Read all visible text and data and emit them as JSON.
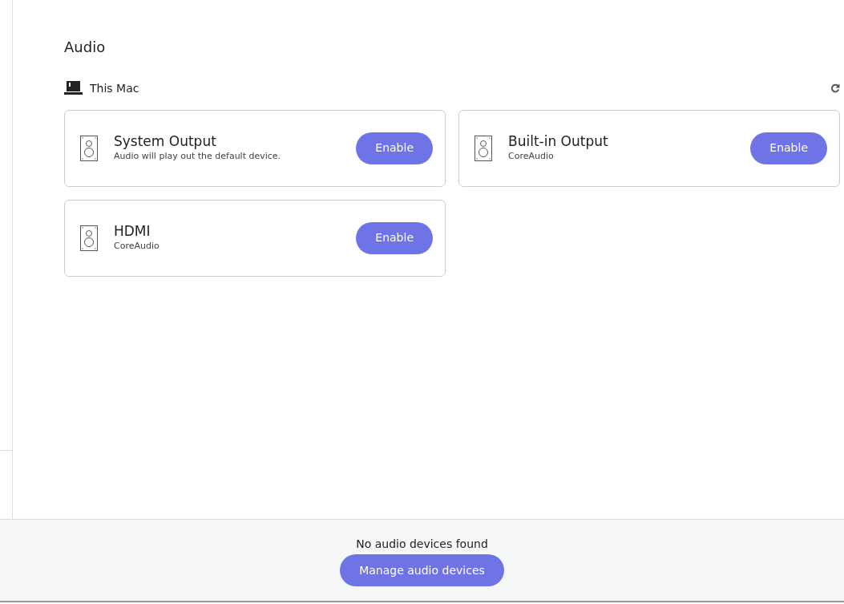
{
  "section": {
    "title": "Audio"
  },
  "host": {
    "label": "This Mac"
  },
  "devices": [
    {
      "name": "System Output",
      "detail": "Audio will play out the default device.",
      "action": "Enable"
    },
    {
      "name": "Built-in Output",
      "detail": "CoreAudio",
      "action": "Enable"
    },
    {
      "name": "HDMI",
      "detail": "CoreAudio",
      "action": "Enable"
    }
  ],
  "footer": {
    "message": "No audio devices found",
    "button": "Manage audio devices"
  }
}
